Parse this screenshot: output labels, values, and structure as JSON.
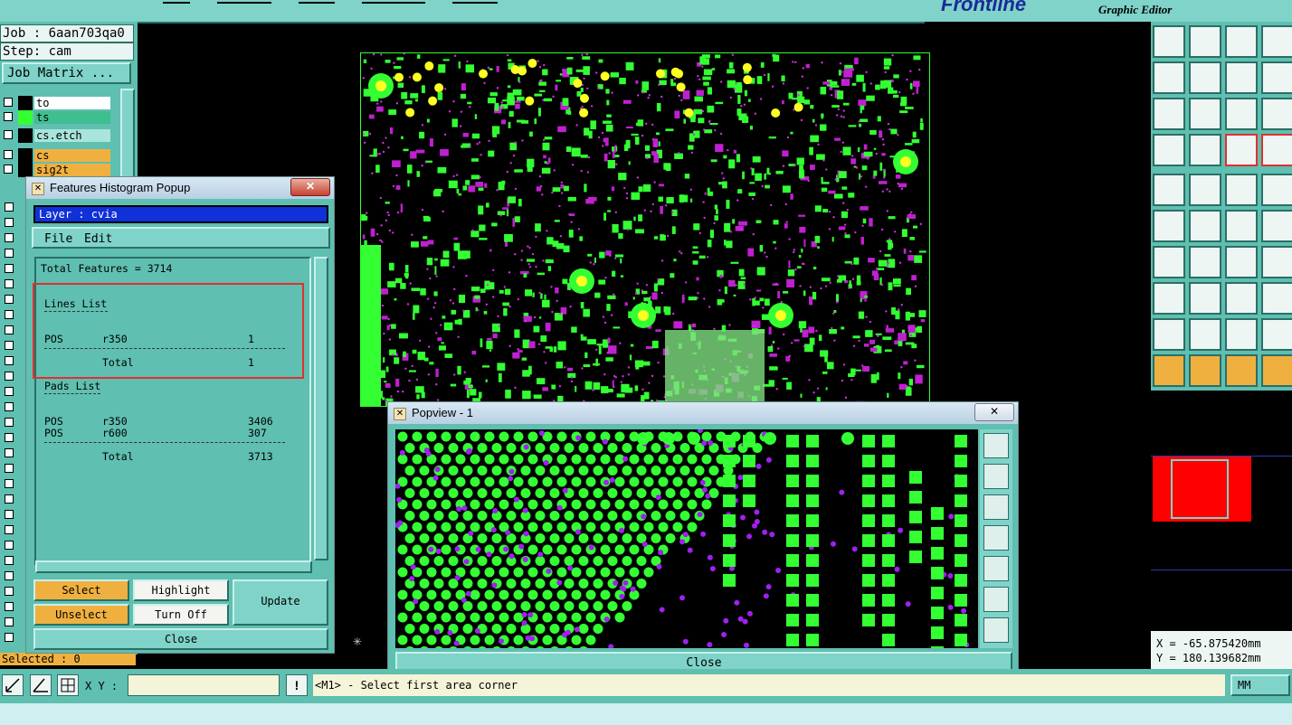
{
  "brand": {
    "logo": "Frontline",
    "subtitle": "Graphic Editor"
  },
  "left_panel": {
    "job_label": "Job : 6aan703qa0",
    "step_label": "Step: cam",
    "job_matrix_button": "Job Matrix ...",
    "layers": [
      {
        "name": "to",
        "color": "#ffffff"
      },
      {
        "name": "ts",
        "color": "#3fbf8f"
      },
      {
        "name": "cs.etch",
        "color": "#7fd3c8"
      },
      {
        "name": "cs",
        "color": "#f0b040"
      },
      {
        "name": "sig2t",
        "color": "#f0b040"
      }
    ],
    "selected_text": "Selected : 0"
  },
  "histogram": {
    "title": "Features Histogram Popup",
    "close_x": "✕",
    "layer_field": "Layer :  cvia",
    "menu": {
      "file": "File",
      "edit": "Edit"
    },
    "total_features": "Total Features = 3714",
    "lines_header": "Lines List",
    "lines": [
      {
        "pos": "POS",
        "sym": "r350",
        "count": "1"
      }
    ],
    "lines_total_label": "Total",
    "lines_total": "1",
    "pads_header": "Pads List",
    "pads": [
      {
        "pos": "POS",
        "sym": "r350",
        "count": "3406"
      },
      {
        "pos": "POS",
        "sym": "r600",
        "count": "307"
      }
    ],
    "pads_total_label": "Total",
    "pads_total": "3713",
    "buttons": {
      "select": "Select",
      "highlight": "Highlight",
      "unselect": "Unselect",
      "turn_off": "Turn Off",
      "update": "Update",
      "close": "Close"
    }
  },
  "popview": {
    "title": "Popview - 1",
    "close_x": "✕",
    "close_button": "Close"
  },
  "coords": {
    "x": "X = -65.875420mm",
    "y": "Y = 180.139682mm"
  },
  "bottom": {
    "xy_label": "X Y :",
    "status_message": "<M1> - Select first area corner",
    "units": "MM",
    "info_icon": "!"
  }
}
